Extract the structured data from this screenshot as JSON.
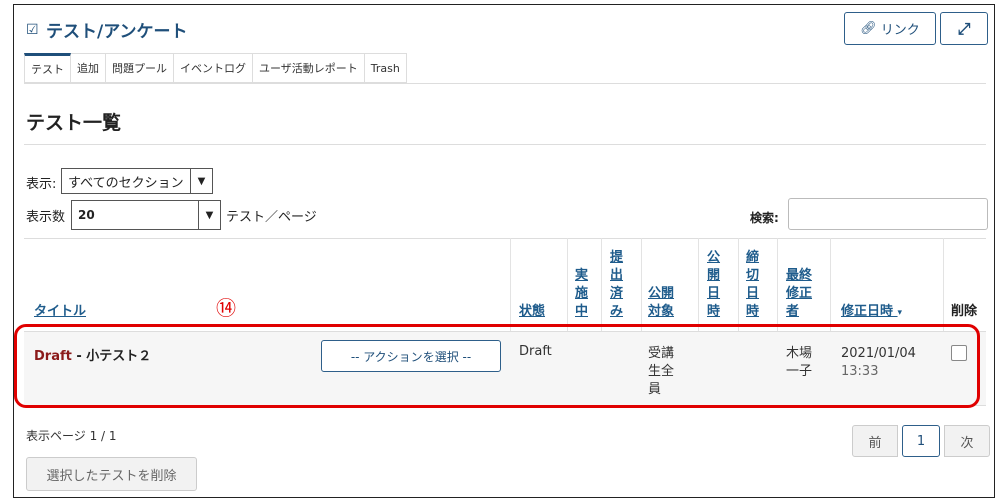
{
  "header": {
    "title": "テスト/アンケート",
    "link_label": "リンク"
  },
  "tabs": [
    "テスト",
    "追加",
    "問題プール",
    "イベントログ",
    "ユーザ活動レポート",
    "Trash"
  ],
  "heading": "テスト一覧",
  "filter": {
    "view_label": "表示:",
    "view_value": "すべてのセクション",
    "count_label": "表示数",
    "count_value": "20",
    "count_suffix": "テスト／ページ",
    "search_label": "検索:"
  },
  "table": {
    "columns": {
      "title": "タイトル",
      "status": "状態",
      "active": "実施中",
      "submitted": "提出済み",
      "target": "公開対象",
      "open_date": "公開日時",
      "close_date": "締切日時",
      "modifier": "最終修正者",
      "modified": "修正日時",
      "delete": "削除"
    },
    "rows": [
      {
        "prefix": "Draft",
        "title": " - 小テスト２",
        "action": "-- アクションを選択 --",
        "status": "Draft",
        "target": "受講生全員",
        "modifier": "木場一子",
        "modified_date": "2021/01/04",
        "modified_time": "13:33"
      }
    ]
  },
  "annotation": "⑭",
  "footer": {
    "page_info": "表示ページ 1 / 1",
    "prev": "前",
    "current": "1",
    "next": "次",
    "delete_selected": "選択したテストを削除"
  },
  "colors": {
    "accent": "#1f4f7a",
    "highlight": "#e00000",
    "draft": "#8b1a1a"
  }
}
